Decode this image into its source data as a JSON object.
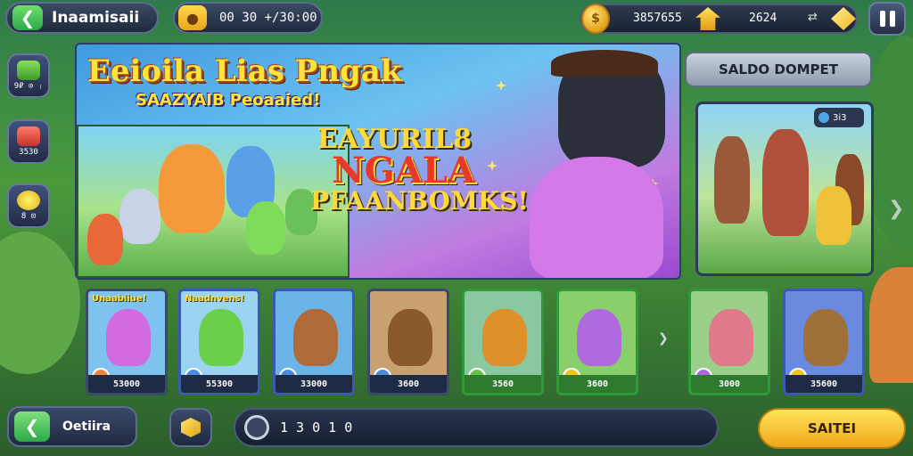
{
  "header": {
    "title": "Inaamisaii",
    "timer": "00 30 +/30:00",
    "coins": "3857655",
    "gems": "2624"
  },
  "sidebar": {
    "items": [
      {
        "label": "9₽ ⊙ ₍",
        "icon": "green-gift-icon",
        "color": "#6ac04a"
      },
      {
        "label": "3530",
        "icon": "red-chest-icon",
        "color": "#e0483a"
      },
      {
        "label": "8 ⊡",
        "icon": "yellow-face-icon",
        "color": "#f0c41a"
      }
    ]
  },
  "banner": {
    "title": "Eeioila Lias Pngak",
    "subtitle": "SAAZYAIB Peoaaied!",
    "promo_line1": "EAYURIL8",
    "promo_line2": "NGALA",
    "promo_line3": "PFAANBOMKS!"
  },
  "right_panel": {
    "button_label": "SALDO DOMPET",
    "badge_text": "3i3"
  },
  "cards": [
    {
      "top_label": "Unaabiiue!",
      "price": "53000",
      "bg": "#7ec3f0",
      "char_color": "#d26ae0",
      "badge_color": "#f0843a"
    },
    {
      "top_label": "Naadnvens!",
      "price": "55300",
      "bg": "#9ad4f0",
      "char_color": "#6ad04a",
      "badge_color": "#4a8ae0"
    },
    {
      "top_label": "",
      "price": "33000",
      "bg": "#6ab4e8",
      "char_color": "#b06a3a",
      "badge_color": "#4a8ae0"
    },
    {
      "top_label": "",
      "price": "3600",
      "bg": "#c9a070",
      "char_color": "#8a5a2a",
      "badge_color": "#4a8ae0"
    },
    {
      "top_label": "",
      "price": "3560",
      "bg": "#8ac8a0",
      "char_color": "#e0902a",
      "badge_color": "#6ac04a"
    },
    {
      "top_label": "",
      "price": "3600",
      "bg": "#8ad06a",
      "char_color": "#b06ae0",
      "badge_color": "#f0c41a"
    },
    {
      "top_label": "",
      "price": "3000",
      "bg": "#9ad08a",
      "char_color": "#e07a8a",
      "badge_color": "#b06ae0"
    },
    {
      "top_label": "",
      "price": "35600",
      "bg": "#6a8ae0",
      "char_color": "#a0703a",
      "badge_color": "#f0c41a"
    }
  ],
  "footer": {
    "back_label": "Oetiira",
    "search_value": "1 3 0 1 0",
    "start_label": "SAITEI"
  }
}
